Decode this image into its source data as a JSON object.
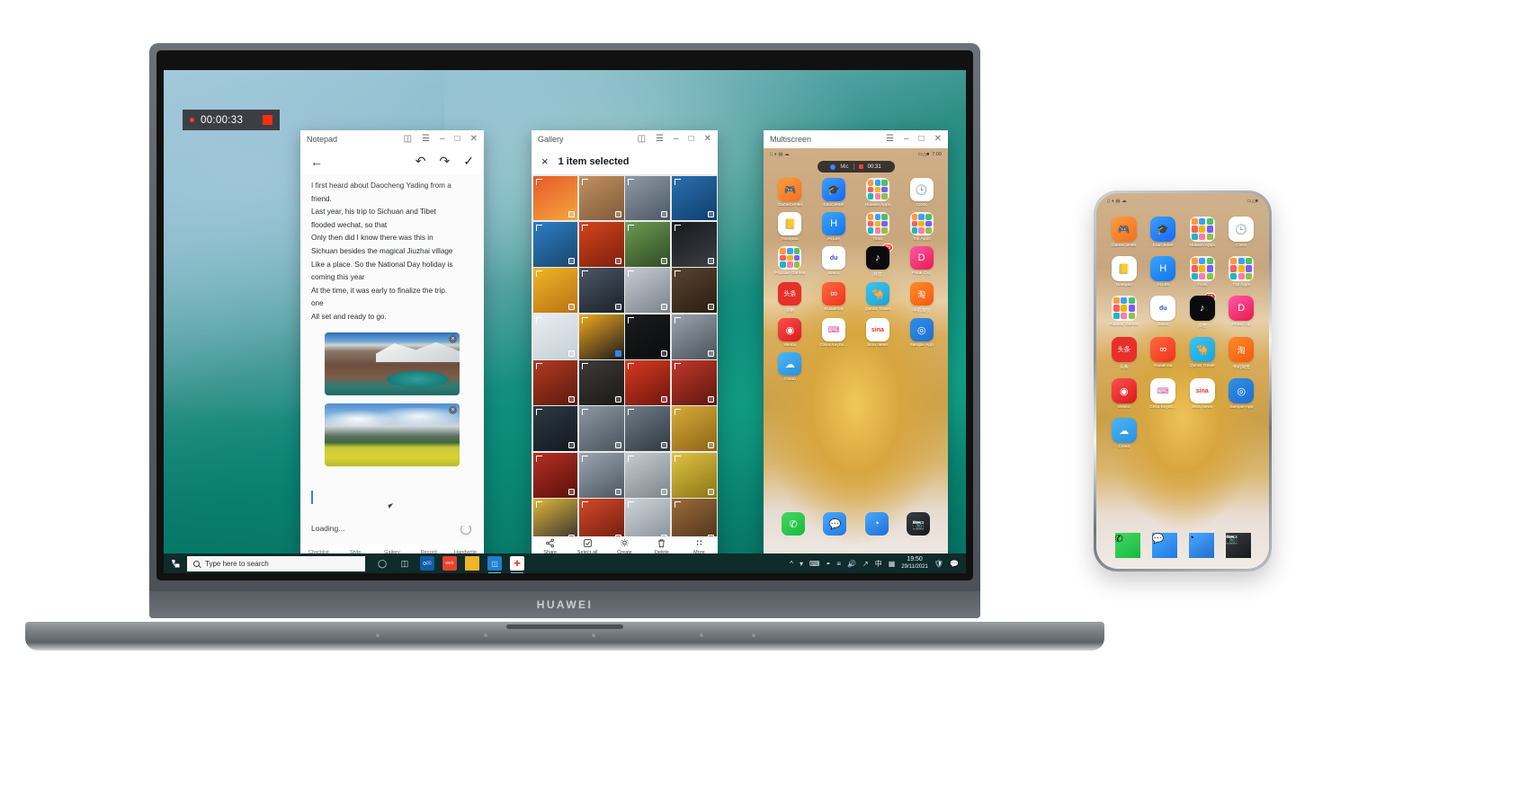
{
  "brand": {
    "laptop_logo": "HUAWEI"
  },
  "recorder": {
    "time": "00:00:33",
    "dot": "record-dot",
    "stop": "stop-square"
  },
  "notepad": {
    "title": "Notepad",
    "titlebar_icons": [
      "fullscreen-icon",
      "menu-icon",
      "minimize-icon",
      "maximize-icon",
      "close-icon"
    ],
    "toolbar": {
      "back": "back-arrow-icon",
      "undo": "undo-icon",
      "redo": "redo-icon",
      "done": "check-icon"
    },
    "lines": [
      "I first heard about Daocheng Yading from a",
      "friend.",
      "Last year, his trip to Sichuan and Tibet",
      "flooded wechat, so that",
      "Only then did I know there was this in",
      "Sichuan besides the magical Jiuzhai village",
      "Like a place. So the National Day holiday is",
      "coming this year",
      "At the time, it was early to finalize the trip.",
      "one",
      "All set and ready to go."
    ],
    "images": [
      {
        "name": "mountain-lake-photo",
        "remove": "×"
      },
      {
        "name": "rapeseed-field-photo",
        "remove": "×"
      }
    ],
    "status": "Loading...",
    "bottom_tools": [
      "Checklist",
      "Style",
      "Gallery",
      "Record",
      "Handwrite"
    ]
  },
  "gallery": {
    "title": "Gallery",
    "titlebar_icons": [
      "fullscreen-icon",
      "menu-icon",
      "minimize-icon",
      "maximize-icon",
      "close-icon"
    ],
    "selection": {
      "close": "×",
      "label": "1 item selected"
    },
    "thumbnails": [
      {
        "c1": "#e8582a",
        "c2": "#f3a63d",
        "sel": false
      },
      {
        "c1": "#c4905f",
        "c2": "#7d5a3a",
        "sel": false
      },
      {
        "c1": "#8f9aa6",
        "c2": "#4d5865",
        "sel": false
      },
      {
        "c1": "#2b6fb0",
        "c2": "#0e3f6d",
        "sel": false
      },
      {
        "c1": "#2e7ec4",
        "c2": "#19456f",
        "sel": false
      },
      {
        "c1": "#d4451d",
        "c2": "#7d1e0c",
        "sel": false
      },
      {
        "c1": "#6e9b52",
        "c2": "#2f4a24",
        "sel": false
      },
      {
        "c1": "#17191c",
        "c2": "#3a3f45",
        "sel": false
      },
      {
        "c1": "#f0b52a",
        "c2": "#b8720f",
        "sel": false
      },
      {
        "c1": "#4c5866",
        "c2": "#1a2028",
        "sel": false
      },
      {
        "c1": "#c6ccd2",
        "c2": "#7b828a",
        "sel": false
      },
      {
        "c1": "#5a4430",
        "c2": "#2a1d12",
        "sel": false
      },
      {
        "c1": "#e9eef2",
        "c2": "#c4ced6",
        "sel": false
      },
      {
        "c1": "#f2a81e",
        "c2": "#1a1a1c",
        "sel": true
      },
      {
        "c1": "#1a1c1f",
        "c2": "#0a0b0d",
        "sel": false
      },
      {
        "c1": "#9aa3ad",
        "c2": "#4a525b",
        "sel": false
      },
      {
        "c1": "#b23a22",
        "c2": "#5c1a0e",
        "sel": false
      },
      {
        "c1": "#3f3b38",
        "c2": "#1a1816",
        "sel": false
      },
      {
        "c1": "#d63a22",
        "c2": "#6e160b",
        "sel": false
      },
      {
        "c1": "#c0392b",
        "c2": "#5e160f",
        "sel": false
      },
      {
        "c1": "#2f3a44",
        "c2": "#111820",
        "sel": false
      },
      {
        "c1": "#8d98a3",
        "c2": "#49525b",
        "sel": false
      },
      {
        "c1": "#6f7d88",
        "c2": "#2f3840",
        "sel": false
      },
      {
        "c1": "#d8ab3a",
        "c2": "#8c6415",
        "sel": false
      },
      {
        "c1": "#b53024",
        "c2": "#5a100a",
        "sel": false
      },
      {
        "c1": "#9aa6b0",
        "c2": "#4d565f",
        "sel": false
      },
      {
        "c1": "#c7cdd2",
        "c2": "#7c848b",
        "sel": false
      },
      {
        "c1": "#e0c445",
        "c2": "#8a7414",
        "sel": false
      },
      {
        "c1": "#e2b63a",
        "c2": "#2a2b2e",
        "sel": false
      },
      {
        "c1": "#d34a2a",
        "c2": "#6b1a0d",
        "sel": false
      },
      {
        "c1": "#cfd5da",
        "c2": "#858d95",
        "sel": false
      },
      {
        "c1": "#9c6b3a",
        "c2": "#4a3119",
        "sel": false
      }
    ],
    "toolbar": [
      {
        "label": "Share",
        "icon": "share-icon"
      },
      {
        "label": "Select all",
        "icon": "select-all-icon"
      },
      {
        "label": "Create",
        "icon": "create-icon"
      },
      {
        "label": "Delete",
        "icon": "trash-icon"
      },
      {
        "label": "More",
        "icon": "more-icon"
      }
    ]
  },
  "multiscreen": {
    "title": "Multiscreen",
    "titlebar_icons": [
      "menu-icon",
      "minimize-icon",
      "maximize-icon",
      "close-icon"
    ],
    "status_bar": {
      "left_icons": [
        "sim-icon",
        "wifi-icon",
        "vpn-icon",
        "cloud-icon"
      ],
      "right_icons": [
        "signal-icon",
        "wifi-icon",
        "battery-icon"
      ],
      "time": "7:00"
    },
    "recording_pill": {
      "mic_label": "Mic",
      "time": "00:31"
    },
    "apps": [
      {
        "name": "GameCenter",
        "icon": "gamepad-icon",
        "style": "grad-game",
        "glyph": "🎮"
      },
      {
        "name": "EduCenter",
        "icon": "graduation-cap-icon",
        "style": "grad-edu",
        "glyph": "🎓"
      },
      {
        "name": "Huawei Apps",
        "icon": "folder-icon",
        "style": "folder"
      },
      {
        "name": "Clock",
        "icon": "clock-icon",
        "style": "grad-white",
        "glyph": "🕒"
      },
      {
        "name": "Notepad",
        "icon": "notes-icon",
        "style": "grad-white",
        "glyph": "📒"
      },
      {
        "name": "AI Life",
        "icon": "ailife-icon",
        "style": "grad-ailife",
        "glyph": "H"
      },
      {
        "name": "Tools",
        "icon": "folder-icon",
        "style": "folder"
      },
      {
        "name": "Top Apps",
        "icon": "folder-icon",
        "style": "folder"
      },
      {
        "name": "Popular Games",
        "icon": "folder-icon",
        "style": "folder"
      },
      {
        "name": "Baidu",
        "icon": "baidu-paw-icon",
        "style": "grad-baidu",
        "glyph": "du"
      },
      {
        "name": "抖音",
        "icon": "tiktok-icon",
        "style": "grad-tiktok",
        "glyph": "♪",
        "badge": "29"
      },
      {
        "name": "Petal Clip",
        "icon": "petal-clip-icon",
        "style": "grad-petal",
        "glyph": "D"
      },
      {
        "name": "头条",
        "icon": "toutiao-icon",
        "style": "grad-toutiao",
        "glyph": "头条"
      },
      {
        "name": "Kuaishou",
        "icon": "kuaishou-icon",
        "style": "grad-kuai",
        "glyph": "∞"
      },
      {
        "name": "Qunar Travel",
        "icon": "camel-icon",
        "style": "grad-qunar",
        "glyph": "🐪"
      },
      {
        "name": "手机淘宝",
        "icon": "taobao-icon",
        "style": "grad-taobao",
        "glyph": "淘"
      },
      {
        "name": "Weibo",
        "icon": "eye-icon",
        "style": "grad-red",
        "glyph": "◉"
      },
      {
        "name": "Celia Keybo...",
        "icon": "keyboard-icon",
        "style": "grad-celia",
        "glyph": "⌨"
      },
      {
        "name": "Sina News",
        "icon": "sina-icon",
        "style": "grad-sina",
        "glyph": "sina"
      },
      {
        "name": "Sample App",
        "icon": "sample-app-icon",
        "style": "grad-sample",
        "glyph": "◎"
      },
      {
        "name": "Cloud",
        "icon": "cloud-icon",
        "style": "grad-cloud",
        "glyph": "☁"
      }
    ],
    "dock": [
      {
        "name": "Phone",
        "icon": "phone-icon",
        "style": "grad-phone",
        "glyph": "✆"
      },
      {
        "name": "Messages",
        "icon": "message-icon",
        "style": "grad-msg",
        "glyph": "💬"
      },
      {
        "name": "Browser",
        "icon": "browser-icon",
        "style": "grad-browser",
        "glyph": "◔"
      },
      {
        "name": "Camera",
        "icon": "camera-icon",
        "style": "grad-cam",
        "glyph": "📷"
      }
    ],
    "nav": [
      "back-button",
      "home-button",
      "recents-button"
    ]
  },
  "taskbar": {
    "start": "windows-start-icon",
    "search_placeholder": "Type here to search",
    "icons": [
      "cortana-icon",
      "task-view-icon",
      "outlook-icon",
      "office-icon",
      "file-explorer-icon",
      "multiscreen-icon",
      "pc-manager-icon"
    ],
    "tray": [
      "chevron-up-icon",
      "pen-icon",
      "touch-keyboard-icon",
      "network-icon",
      "settings-icon",
      "volume-icon",
      "share-icon",
      "ime-cn-icon",
      "qr-icon"
    ],
    "clock": {
      "time": "19:50",
      "date": "29/11/2021"
    },
    "tray_right": [
      "defender-icon",
      "signal-icon",
      "notification-icon"
    ]
  },
  "phone": {
    "status_bar": {
      "left_icons": [
        "sim-icon",
        "wifi-icon",
        "vpn-icon",
        "cloud-icon"
      ],
      "right_icons": [
        "signal-icon",
        "wifi-icon",
        "battery-icon"
      ]
    },
    "apps": [
      {
        "name": "GameCenter",
        "icon": "gamepad-icon",
        "style": "grad-game",
        "glyph": "🎮"
      },
      {
        "name": "EduCenter",
        "icon": "graduation-cap-icon",
        "style": "grad-edu",
        "glyph": "🎓"
      },
      {
        "name": "Huawei Apps",
        "icon": "folder-icon",
        "style": "folder"
      },
      {
        "name": "Clock",
        "icon": "clock-icon",
        "style": "grad-white",
        "glyph": "🕒"
      },
      {
        "name": "Notepad",
        "icon": "notes-icon",
        "style": "grad-white",
        "glyph": "📒"
      },
      {
        "name": "AI Life",
        "icon": "ailife-icon",
        "style": "grad-ailife",
        "glyph": "H"
      },
      {
        "name": "Tools",
        "icon": "folder-icon",
        "style": "folder"
      },
      {
        "name": "Top Apps",
        "icon": "folder-icon",
        "style": "folder"
      },
      {
        "name": "Popular Games",
        "icon": "folder-icon",
        "style": "folder"
      },
      {
        "name": "Baidu",
        "icon": "baidu-paw-icon",
        "style": "grad-baidu",
        "glyph": "du"
      },
      {
        "name": "抖音",
        "icon": "tiktok-icon",
        "style": "grad-tiktok",
        "glyph": "♪",
        "badge": "29"
      },
      {
        "name": "Petal Clip",
        "icon": "petal-clip-icon",
        "style": "grad-petal",
        "glyph": "D"
      },
      {
        "name": "头条",
        "icon": "toutiao-icon",
        "style": "grad-toutiao",
        "glyph": "头条"
      },
      {
        "name": "Kuaishou",
        "icon": "kuaishou-icon",
        "style": "grad-kuai",
        "glyph": "∞"
      },
      {
        "name": "Qunar Travel",
        "icon": "camel-icon",
        "style": "grad-qunar",
        "glyph": "🐪"
      },
      {
        "name": "手机淘宝",
        "icon": "taobao-icon",
        "style": "grad-taobao",
        "glyph": "淘"
      },
      {
        "name": "Weibo",
        "icon": "eye-icon",
        "style": "grad-red",
        "glyph": "◉"
      },
      {
        "name": "Celia Keybo...",
        "icon": "keyboard-icon",
        "style": "grad-celia",
        "glyph": "⌨"
      },
      {
        "name": "Sina News",
        "icon": "sina-icon",
        "style": "grad-sina",
        "glyph": "sina"
      },
      {
        "name": "Sample App",
        "icon": "sample-app-icon",
        "style": "grad-sample",
        "glyph": "◎"
      },
      {
        "name": "Cloud",
        "icon": "cloud-icon",
        "style": "grad-cloud",
        "glyph": "☁"
      }
    ],
    "dock": [
      {
        "name": "Phone",
        "icon": "phone-icon",
        "style": "grad-phone",
        "glyph": "✆"
      },
      {
        "name": "Messages",
        "icon": "message-icon",
        "style": "grad-msg",
        "glyph": "💬"
      },
      {
        "name": "Browser",
        "icon": "browser-icon",
        "style": "grad-browser",
        "glyph": "◔"
      },
      {
        "name": "Camera",
        "icon": "camera-icon",
        "style": "grad-cam",
        "glyph": "📷"
      }
    ]
  },
  "colors": {
    "accent": "#0f8e7e",
    "record": "#ff3b30",
    "taskbar": "#0f2b2a",
    "select": "#2e86ff"
  }
}
